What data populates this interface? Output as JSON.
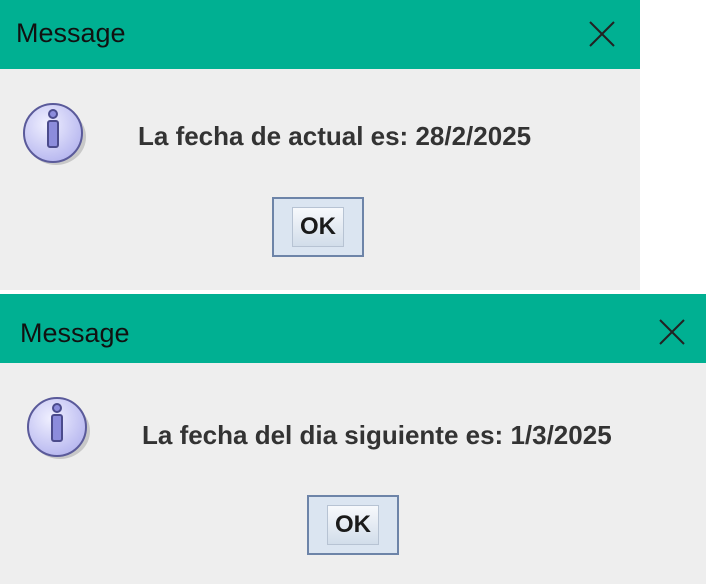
{
  "dialogs": [
    {
      "title": "Message",
      "message": "La fecha de actual es: 28/2/2025",
      "ok_label": "OK",
      "icon": "information-icon"
    },
    {
      "title": "Message",
      "message": "La fecha del dia siguiente es: 1/3/2025",
      "ok_label": "OK",
      "icon": "information-icon"
    }
  ],
  "colors": {
    "title_bar": "#00b092",
    "dialog_background": "#eeeeee",
    "button_border": "#6d84a8"
  }
}
